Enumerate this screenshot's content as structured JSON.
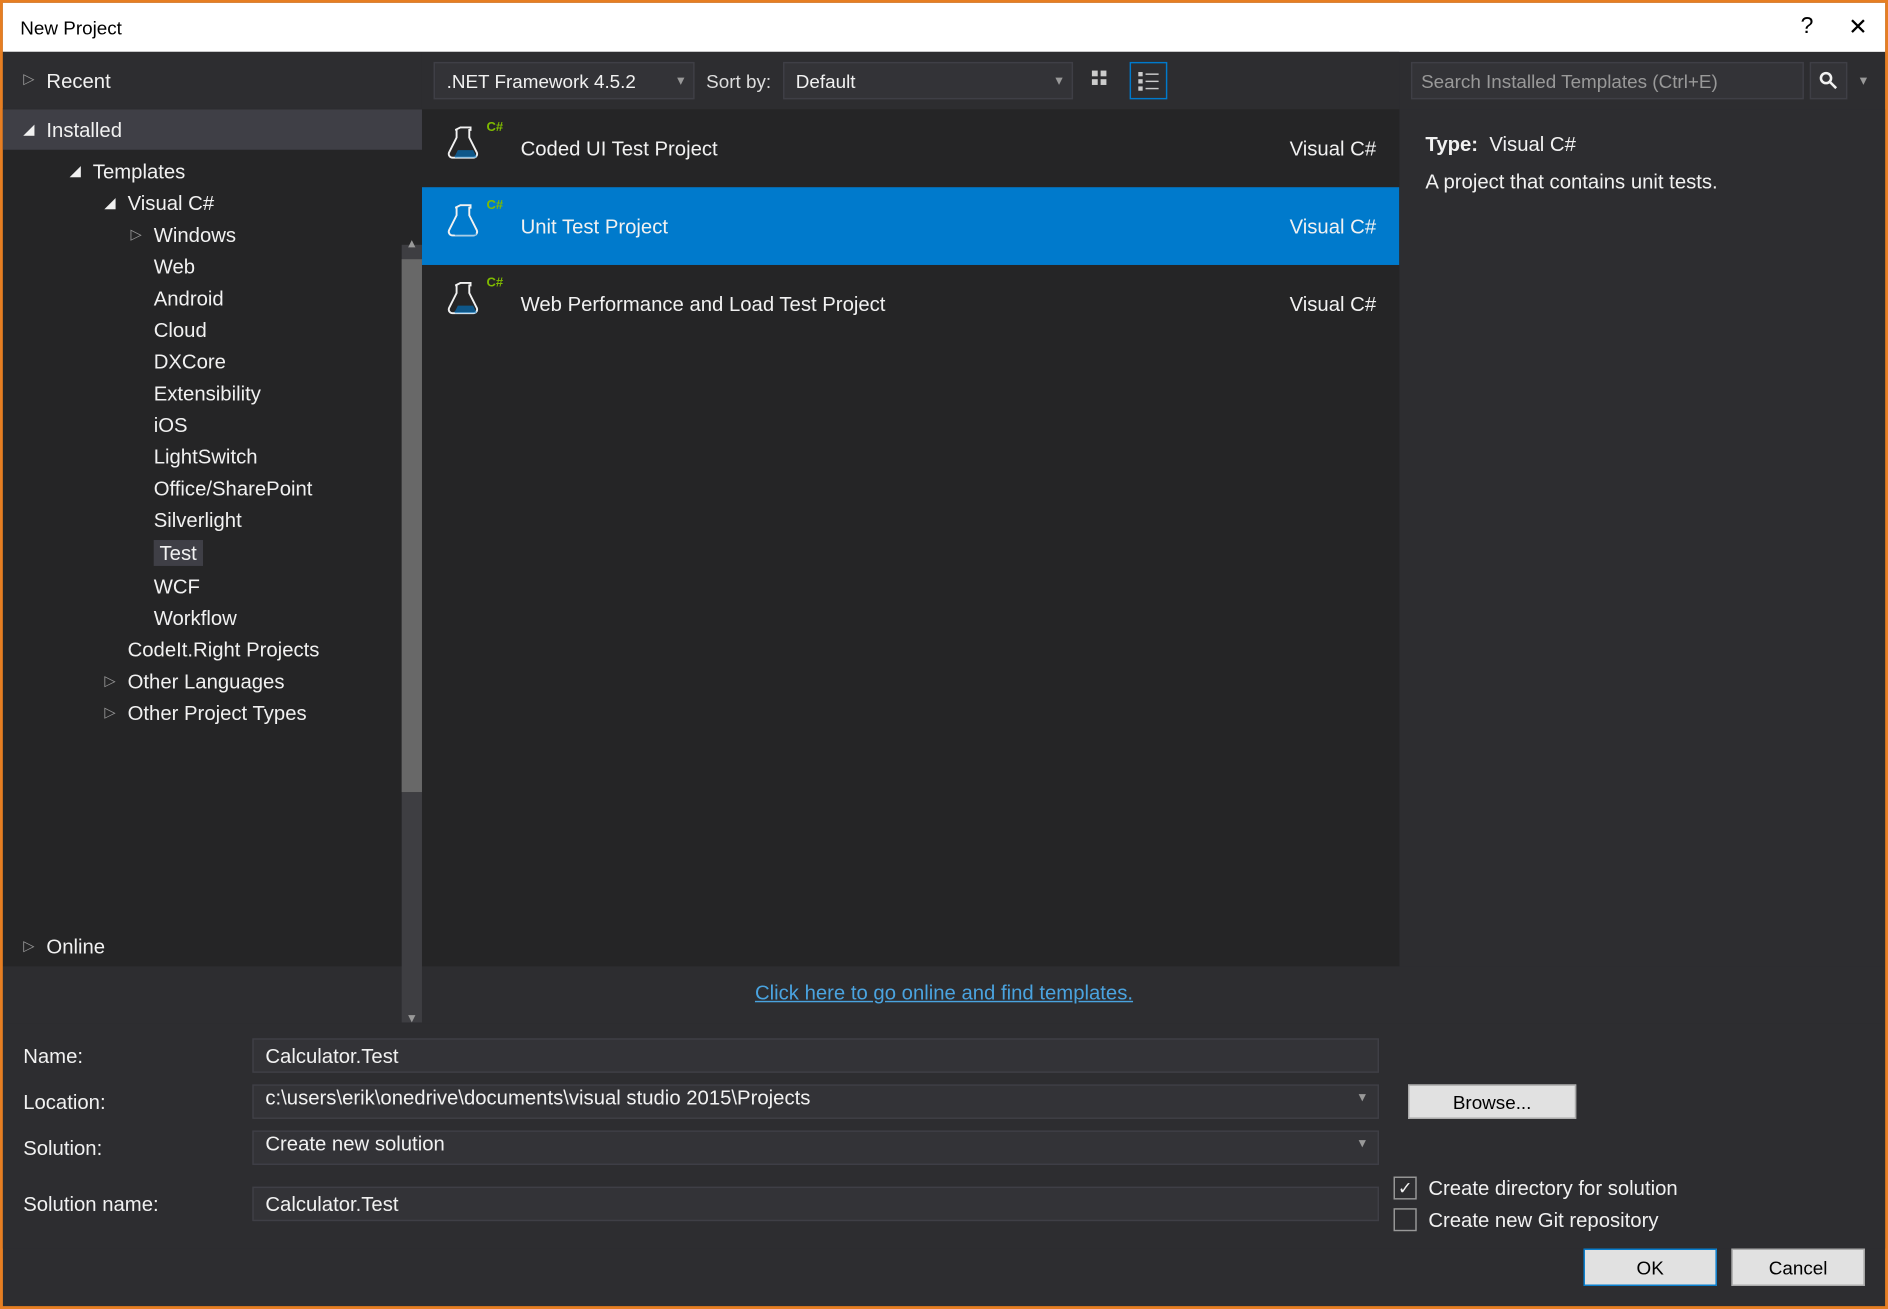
{
  "window": {
    "title": "New Project"
  },
  "sidebar": {
    "recent": "Recent",
    "installed": "Installed",
    "templates": "Templates",
    "visual_csharp": "Visual C#",
    "categories": [
      "Windows",
      "Web",
      "Android",
      "Cloud",
      "DXCore",
      "Extensibility",
      "iOS",
      "LightSwitch",
      "Office/SharePoint",
      "Silverlight",
      "Test",
      "WCF",
      "Workflow"
    ],
    "codeit": "CodeIt.Right Projects",
    "other_langs": "Other Languages",
    "other_types": "Other Project Types",
    "online": "Online"
  },
  "toolbar": {
    "framework": ".NET Framework 4.5.2",
    "sort_label": "Sort by:",
    "sort_value": "Default",
    "search_placeholder": "Search Installed Templates (Ctrl+E)"
  },
  "templates": [
    {
      "name": "Coded UI Test Project",
      "lang": "Visual C#",
      "selected": false
    },
    {
      "name": "Unit Test Project",
      "lang": "Visual C#",
      "selected": true
    },
    {
      "name": "Web Performance and Load Test Project",
      "lang": "Visual C#",
      "selected": false
    }
  ],
  "detail": {
    "type_label": "Type:",
    "type_value": "Visual C#",
    "description": "A project that contains unit tests."
  },
  "link": "Click here to go online and find templates.",
  "form": {
    "name_label": "Name:",
    "name_value": "Calculator.Test",
    "location_label": "Location:",
    "location_value": "c:\\users\\erik\\onedrive\\documents\\visual studio 2015\\Projects",
    "browse": "Browse...",
    "solution_label": "Solution:",
    "solution_value": "Create new solution",
    "solution_name_label": "Solution name:",
    "solution_name_value": "Calculator.Test",
    "create_dir": "Create directory for solution",
    "create_git": "Create new Git repository"
  },
  "buttons": {
    "ok": "OK",
    "cancel": "Cancel"
  }
}
